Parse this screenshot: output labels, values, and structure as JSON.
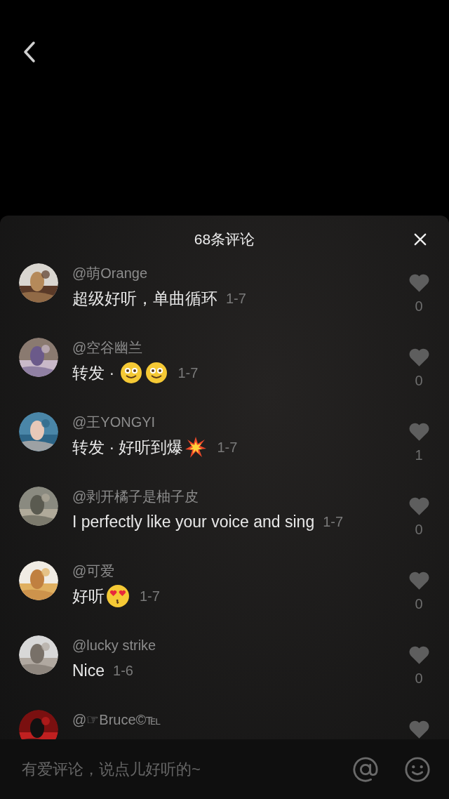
{
  "header": {
    "title": "68条评论"
  },
  "comments": [
    {
      "user": "@萌Orange",
      "content": [
        {
          "kind": "text",
          "text": "超级好听，单曲循环"
        }
      ],
      "time": "1-7",
      "likes": "0"
    },
    {
      "user": "@空谷幽兰",
      "content": [
        {
          "kind": "text",
          "text": "转发 · "
        },
        {
          "kind": "smile"
        },
        {
          "kind": "smile"
        }
      ],
      "time": "1-7",
      "likes": "0"
    },
    {
      "user": "@王YONGYI",
      "content": [
        {
          "kind": "text",
          "text": "转发 · 好听到爆"
        },
        {
          "kind": "blast"
        }
      ],
      "time": "1-7",
      "likes": "1"
    },
    {
      "user": "@剥开橘子是柚子皮",
      "content": [
        {
          "kind": "text",
          "text": "I perfectly like your voice and sing"
        }
      ],
      "time": "1-7",
      "likes": "0"
    },
    {
      "user": "@可爱",
      "content": [
        {
          "kind": "text",
          "text": "好听"
        },
        {
          "kind": "love"
        }
      ],
      "time": "1-7",
      "likes": "0"
    },
    {
      "user": "@lucky strike",
      "content": [
        {
          "kind": "text",
          "text": "Nice"
        }
      ],
      "time": "1-6",
      "likes": "0"
    },
    {
      "user": "@☞Bruce©℡"
    }
  ],
  "input": {
    "placeholder": "有爱评论，说点儿好听的~"
  }
}
